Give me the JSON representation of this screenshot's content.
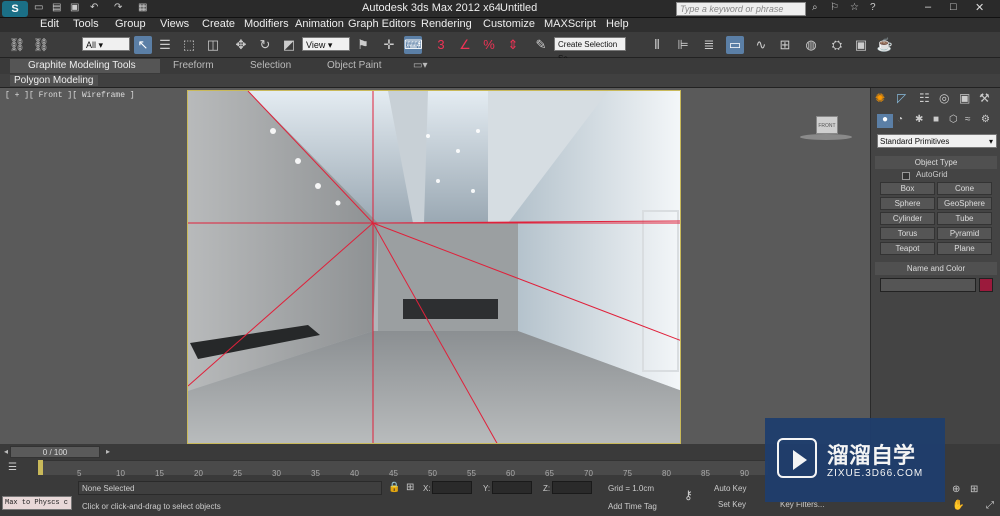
{
  "window": {
    "app_title": "Autodesk 3ds Max  2012 x64",
    "doc_title": "Untitled",
    "search_placeholder": "Type a keyword or phrase"
  },
  "menu": [
    "Edit",
    "Tools",
    "Group",
    "Views",
    "Create",
    "Modifiers",
    "Animation",
    "Graph Editors",
    "Rendering",
    "Customize",
    "MAXScript",
    "Help"
  ],
  "toolbar": {
    "filter_value": "All",
    "coord_value": "View",
    "selection_set_value": "Create Selection Se"
  },
  "ribbon": {
    "tabs": [
      "Graphite Modeling Tools",
      "Freeform",
      "Selection",
      "Object Paint"
    ],
    "subtab": "Polygon Modeling"
  },
  "viewport": {
    "label": "[ + ][ Front ][ Wireframe ]",
    "viewcube_label": "FRONT"
  },
  "command_panel": {
    "category": "Standard Primitives",
    "object_type_title": "Object Type",
    "autogrid_label": "AutoGrid",
    "buttons": [
      "Box",
      "Cone",
      "Sphere",
      "GeoSphere",
      "Cylinder",
      "Tube",
      "Torus",
      "Pyramid",
      "Teapot",
      "Plane"
    ],
    "name_color_title": "Name and Color",
    "object_color": "#9b1a3c"
  },
  "timeline": {
    "frame_counter": "0 / 100",
    "ticks": [
      "5",
      "10",
      "15",
      "20",
      "25",
      "30",
      "35",
      "40",
      "45",
      "50",
      "55",
      "60",
      "65",
      "70",
      "75",
      "80",
      "85",
      "90"
    ]
  },
  "status": {
    "listener": "Max to Physcs c",
    "selection": "None Selected",
    "prompt": "Click or click-and-drag to select objects",
    "x_label": "X:",
    "y_label": "Y:",
    "z_label": "Z:",
    "grid": "Grid = 1.0cm",
    "add_time_tag": "Add Time Tag",
    "auto_key": "Auto Key",
    "set_key": "Set Key",
    "key_filters": "Key Filters..."
  },
  "watermark": {
    "brand": "溜溜自学",
    "url": "ZIXUE.3D66.COM"
  }
}
